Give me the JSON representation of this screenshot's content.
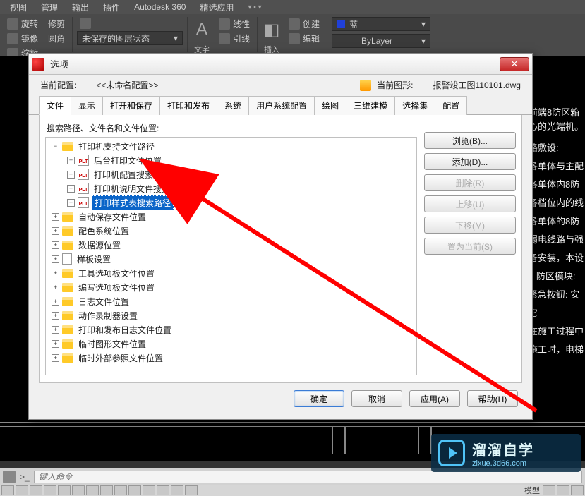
{
  "menubar": [
    "视图",
    "管理",
    "输出",
    "插件",
    "Autodesk 360",
    "精选应用"
  ],
  "ribbon": {
    "group1": [
      "旋转",
      "修剪"
    ],
    "group2": [
      "镜像",
      "圆角"
    ],
    "group3_label": "缩放",
    "mod_label": "修",
    "layer_state": "未保存的图层状态",
    "big_labels": {
      "text": "文字",
      "leader": "引线",
      "insert": "插入"
    },
    "group_line": [
      "线性",
      "创建"
    ],
    "group_line2": [
      "引线",
      "编辑"
    ],
    "color_label": "蓝",
    "bylayer": "ByLayer"
  },
  "dialog": {
    "title": "选项",
    "profile_label": "当前配置:",
    "profile_value": "<<未命名配置>>",
    "drawing_label": "当前图形:",
    "drawing_value": "报警竣工图110101.dwg",
    "tabs": [
      "文件",
      "显示",
      "打开和保存",
      "打印和发布",
      "系统",
      "用户系统配置",
      "绘图",
      "三维建模",
      "选择集",
      "配置"
    ],
    "active_tab": 0,
    "tree_label": "搜索路径、文件名和文件位置:",
    "tree": {
      "root_a": "打印机支持文件路径",
      "a1": "后台打印文件位置",
      "a2": "打印机配置搜索路径",
      "a3": "打印机说明文件搜索路径",
      "a4": "打印样式表搜索路径",
      "b": "自动保存文件位置",
      "c": "配色系统位置",
      "d": "数据源位置",
      "e": "样板设置",
      "f": "工具选项板文件位置",
      "g": "编写选项板文件位置",
      "h": "日志文件位置",
      "i": "动作录制器设置",
      "j": "打印和发布日志文件位置",
      "k": "临时图形文件位置",
      "l": "临时外部参照文件位置"
    },
    "buttons": {
      "browse": "浏览(B)...",
      "add": "添加(D)...",
      "remove": "删除(R)",
      "moveup": "上移(U)",
      "movedown": "下移(M)",
      "setcurrent": "置为当前(S)"
    },
    "footer": {
      "ok": "确定",
      "cancel": "取消",
      "apply": "应用(A)",
      "help": "帮助(H)"
    }
  },
  "canvas_text": [
    "前端8防区箱",
    "心的光端机。",
    "路敷设:",
    "各单体与主配",
    "各单体内8防",
    "各档位内的线",
    "各单体的8防",
    "弱电线路与强",
    "备安装，本设",
    "8 防区模块:",
    "紧急按钮: 安",
    "它",
    "在施工过程中",
    "施工时，电梯"
  ],
  "watermark": {
    "title": "溜溜自学",
    "url": "zixue.3d66.com"
  },
  "cmdline": {
    "placeholder": "键入命令"
  },
  "statusbar": {
    "model": "模型"
  }
}
